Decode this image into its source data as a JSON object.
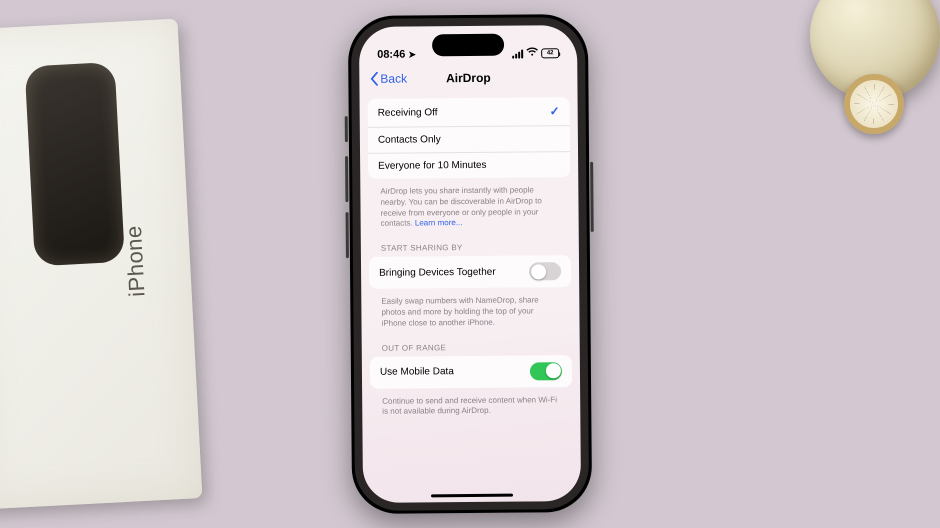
{
  "box_label": "iPhone",
  "status": {
    "time": "08:46",
    "battery": "42"
  },
  "nav": {
    "back": "Back",
    "title": "AirDrop"
  },
  "receiving": {
    "opt_off": "Receiving Off",
    "opt_contacts": "Contacts Only",
    "opt_everyone": "Everyone for 10 Minutes",
    "footer": "AirDrop lets you share instantly with people nearby. You can be discoverable in AirDrop to receive from everyone or only people in your contacts. ",
    "learn_more": "Learn more..."
  },
  "sharing": {
    "header": "START SHARING BY",
    "label": "Bringing Devices Together",
    "footer": "Easily swap numbers with NameDrop, share photos and more by holding the top of your iPhone close to another iPhone."
  },
  "range": {
    "header": "OUT OF RANGE",
    "label": "Use Mobile Data",
    "footer": "Continue to send and receive content when Wi-Fi is not available during AirDrop."
  }
}
